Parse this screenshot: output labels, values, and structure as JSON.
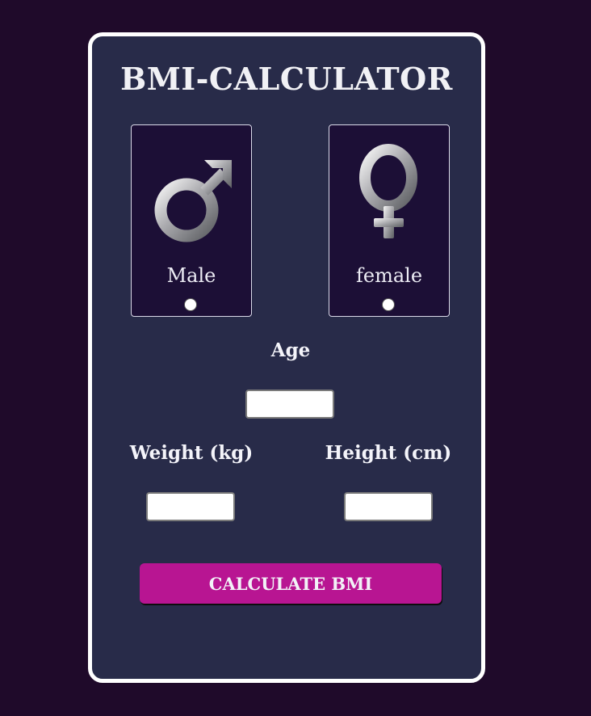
{
  "title": "BMI-CALCULATOR",
  "gender": {
    "male": {
      "label": "Male",
      "icon": "male-symbol-icon"
    },
    "female": {
      "label": "female",
      "icon": "female-symbol-icon"
    }
  },
  "fields": {
    "age": {
      "label": "Age",
      "value": ""
    },
    "weight": {
      "label": "Weight (kg)",
      "value": ""
    },
    "height": {
      "label": "Height (cm)",
      "value": ""
    }
  },
  "button": {
    "label": "CALCULATE BMI"
  },
  "colors": {
    "page_background": "#1f0a2a",
    "card_background": "#282b49",
    "gender_box_background": "#1c0f36",
    "button_background": "#b81592",
    "text": "#f1f1f5"
  }
}
